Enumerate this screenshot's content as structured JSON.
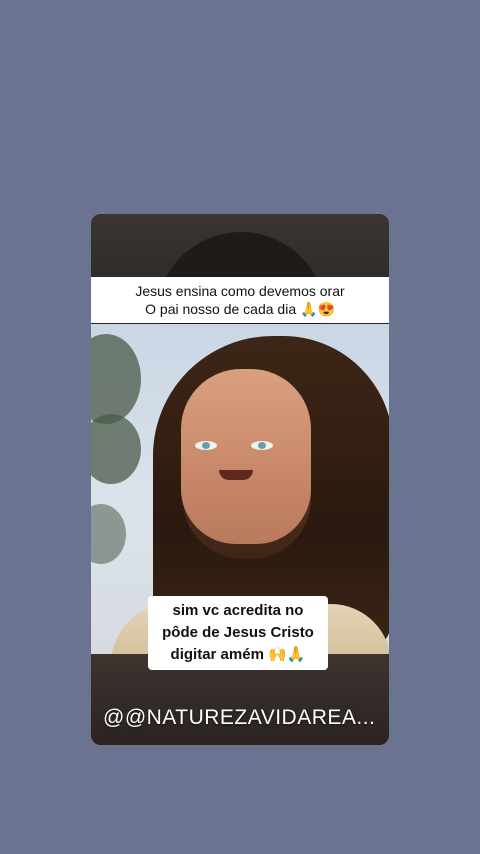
{
  "caption_top": {
    "line1": "Jesus ensina como devemos orar",
    "line2": "O pai nosso de cada dia 🙏😍"
  },
  "caption_mid": {
    "line1": "sim vc acredita no",
    "line2": "pôde de Jesus Cristo",
    "line3": "digitar amém 🙌🙏"
  },
  "watermark": {
    "handle": "@@NATUREZAVIDAREA..."
  },
  "colors": {
    "background": "#6a7491",
    "caption_bg": "#ffffff",
    "caption_text": "#111111"
  }
}
